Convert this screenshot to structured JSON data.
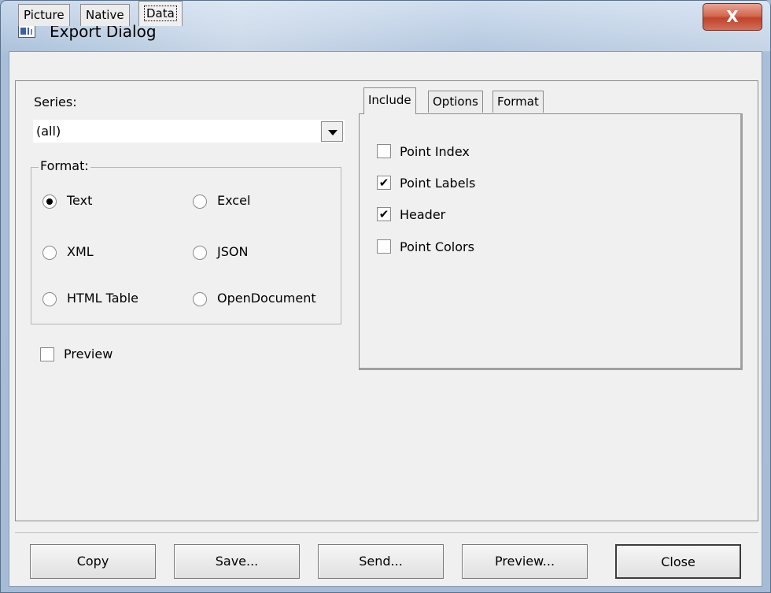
{
  "window": {
    "title": "Export Dialog",
    "close_glyph": "X"
  },
  "outer_tabs": [
    {
      "label": "Picture"
    },
    {
      "label": "Native"
    },
    {
      "label": "Data",
      "active": true
    }
  ],
  "series": {
    "label": "Series:",
    "value": "(all)"
  },
  "format_group": {
    "label": "Format:",
    "options": [
      {
        "label": "Text",
        "checked": true
      },
      {
        "label": "Excel",
        "checked": false
      },
      {
        "label": "XML",
        "checked": false
      },
      {
        "label": "JSON",
        "checked": false
      },
      {
        "label": "HTML Table",
        "checked": false
      },
      {
        "label": "OpenDocument",
        "checked": false
      }
    ]
  },
  "preview_checkbox": {
    "label": "Preview",
    "checked": false
  },
  "inner_tabs": [
    {
      "label": "Include",
      "active": true
    },
    {
      "label": "Options"
    },
    {
      "label": "Format"
    }
  ],
  "include": [
    {
      "label": "Point Index",
      "checked": false
    },
    {
      "label": "Point Labels",
      "checked": true
    },
    {
      "label": "Header",
      "checked": true
    },
    {
      "label": "Point Colors",
      "checked": false
    }
  ],
  "check_glyph": "✔",
  "buttons": [
    {
      "label": "Copy"
    },
    {
      "label": "Save..."
    },
    {
      "label": "Send..."
    },
    {
      "label": "Preview..."
    },
    {
      "label": "Close"
    }
  ]
}
